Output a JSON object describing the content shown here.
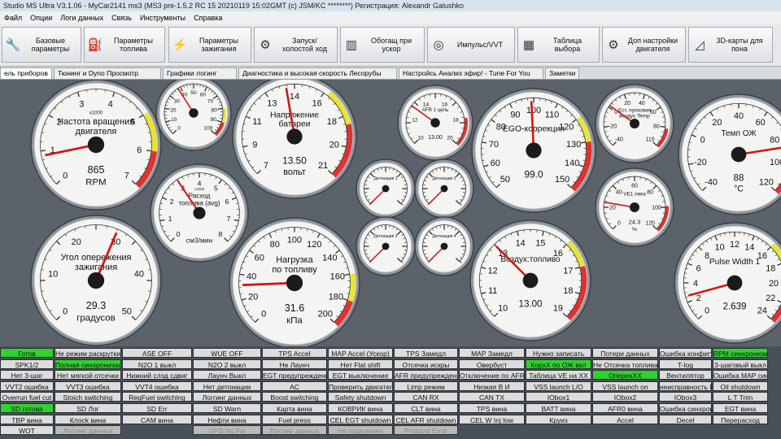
{
  "window": {
    "title": "Studio MS Ultra V3.1.06 - MyCar2141 ms3 (MS3 pre-1.5.2 RC 15  20210119 15:02GMT (c) JSM/KC ********) Регистрация: Alexandr Galushko"
  },
  "menu": [
    "Файл",
    "Опции",
    "Логи данных",
    "Связь",
    "Инструменты",
    "Справка"
  ],
  "toolbar": [
    {
      "label": "Базовые параметры",
      "icon": "wrench-icon",
      "glyph": "🔧"
    },
    {
      "label": "Параметры топлива",
      "icon": "injector-icon",
      "glyph": "⛽"
    },
    {
      "label": "Параметры зажигания",
      "icon": "spark-plug-icon",
      "glyph": "⚡"
    },
    {
      "label": "Запуск/ холостой ход",
      "icon": "idle-valve-icon",
      "glyph": "⚙"
    },
    {
      "label": "Обогащ при ускор",
      "icon": "accel-pedal-icon",
      "glyph": "▥"
    },
    {
      "label": "Импульс/VVT",
      "icon": "turbo-icon",
      "glyph": "◎"
    },
    {
      "label": "Таблица выбора",
      "icon": "table-icon",
      "glyph": "▦"
    },
    {
      "label": "Доп настройки двигателя",
      "icon": "engine-icon",
      "glyph": "⚙"
    },
    {
      "label": "3D-карты для пона",
      "icon": "3d-map-icon",
      "glyph": "◿"
    }
  ],
  "tabs": [
    "ель приборов",
    "Тюнинг и Dyno Просмотр",
    "Графики логинг",
    "Диагностика и высокая скорость Лесорубы",
    "Настройсь Анализ эфир! - Tune For You",
    "Заметки"
  ],
  "gauges": [
    {
      "id": "rpm",
      "title1": "Частота вращения",
      "title2": "двигателя",
      "mult": "x1000",
      "value": "865",
      "unit": "RPM",
      "min": 0,
      "max": 7,
      "val": 0.865,
      "ticks": [
        "0",
        "1",
        "2",
        "3",
        "4",
        "5",
        "6",
        "7"
      ],
      "redFrom": 6,
      "yellowFrom": 5
    },
    {
      "id": "mini-top",
      "title1": "",
      "title2": "",
      "mult": "",
      "value": "",
      "unit": "",
      "min": 0,
      "max": 100,
      "val": 38,
      "ticks": [
        "0",
        "10",
        "20",
        "30",
        "40",
        "50",
        "60",
        "70",
        "80",
        "90",
        "100"
      ],
      "redFrom": 90,
      "yellowFrom": 80
    },
    {
      "id": "battery",
      "title1": "Напряжение",
      "title2": "батареи",
      "mult": "",
      "value": "13.50",
      "unit": "вольт",
      "min": 7,
      "max": 21,
      "val": 13.5,
      "ticks": [
        "7",
        "9",
        "11",
        "13",
        "14",
        "16",
        "18",
        "20",
        "21"
      ],
      "redFrom": 18,
      "yellowFrom": 16
    },
    {
      "id": "fuel-flow",
      "title1": "Расход",
      "title2": "топлива (avg)",
      "mult": "x1000",
      "value": "",
      "unit": "см3/мин",
      "min": 0,
      "max": 8,
      "val": 3.0,
      "ticks": [
        "0",
        "1",
        "2",
        "3",
        "4",
        "5",
        "6",
        "7",
        "8"
      ],
      "redFrom": 99,
      "yellowFrom": 99
    },
    {
      "id": "ign",
      "title1": "Угол опережения",
      "title2": "зажигания",
      "mult": "",
      "value": "29.3",
      "unit": "градусов",
      "min": 0,
      "max": 50,
      "val": 29.3,
      "ticks": [
        "0",
        "10",
        "20",
        "30",
        "40",
        "50"
      ],
      "redFrom": 99,
      "yellowFrom": 99
    },
    {
      "id": "map",
      "title1": "Нагрузка",
      "title2": "по топливу",
      "mult": "",
      "value": "31.6",
      "unit": "кПа",
      "min": 0,
      "max": 200,
      "val": 31.6,
      "ticks": [
        "0",
        "20",
        "40",
        "60",
        "80",
        "100",
        "120",
        "140",
        "160",
        "180",
        "200"
      ],
      "redFrom": 180,
      "yellowFrom": 160
    },
    {
      "id": "afr",
      "title1": "AFR 1 цель",
      "title2": "",
      "mult": "",
      "value": "13.00",
      "unit": "",
      "min": 10,
      "max": 20,
      "val": 13.0,
      "ticks": [
        "10",
        "12",
        "14",
        "16",
        "18",
        "20"
      ],
      "redFrom": 18,
      "yellowFrom": 99
    },
    {
      "id": "knock1",
      "title1": "Детонация 1",
      "title2": "",
      "mult": "",
      "value": "",
      "unit": "",
      "min": 0,
      "max": 100,
      "val": 0,
      "ticks": [],
      "redFrom": 99,
      "yellowFrom": 99
    },
    {
      "id": "knock2",
      "title1": "Детонация 2",
      "title2": "",
      "mult": "",
      "value": "",
      "unit": "",
      "min": 0,
      "max": 100,
      "val": 0,
      "ticks": [],
      "redFrom": 99,
      "yellowFrom": 99
    },
    {
      "id": "knock3",
      "title1": "Детонация 3",
      "title2": "",
      "mult": "",
      "value": "",
      "unit": "",
      "min": 0,
      "max": 100,
      "val": 0,
      "ticks": [],
      "redFrom": 99,
      "yellowFrom": 99
    },
    {
      "id": "knock4",
      "title1": "Детонация 4",
      "title2": "",
      "mult": "",
      "value": "",
      "unit": "",
      "min": 0,
      "max": 100,
      "val": 0,
      "ticks": [],
      "redFrom": 99,
      "yellowFrom": 99
    },
    {
      "id": "ego",
      "title1": "EGO-коррекция",
      "title2": "",
      "mult": "",
      "value": "99.0",
      "unit": "",
      "min": 50,
      "max": 150,
      "val": 99.0,
      "ticks": [
        "50",
        "60",
        "70",
        "80",
        "90",
        "100",
        "110",
        "120",
        "130",
        "140",
        "150"
      ],
      "redFrom": 130,
      "yellowFrom": 120
    },
    {
      "id": "afr-main",
      "title1": "Воздух:топливо",
      "title2": "",
      "mult": "",
      "value": "13.00",
      "unit": "",
      "min": 10,
      "max": 19,
      "val": 13.0,
      "ticks": [
        "10",
        "11",
        "12",
        "13",
        "14",
        "15",
        "16",
        "17",
        "18",
        "19"
      ],
      "redFrom": 17,
      "yellowFrom": 16
    },
    {
      "id": "est",
      "title1": "Ест. пусковая",
      "title2": "воздух Temp",
      "mult": "",
      "value": "",
      "unit": "",
      "min": -40,
      "max": 110,
      "val": 5,
      "ticks": [
        "-40",
        "-20",
        "0",
        "20",
        "40",
        "60",
        "80",
        "110"
      ],
      "redFrom": 90,
      "yellowFrom": 99
    },
    {
      "id": "ve",
      "title1": "VE1 пика",
      "title2": "",
      "mult": "",
      "value": "24.3",
      "unit": "%",
      "min": 0,
      "max": 120,
      "val": 24.3,
      "ticks": [
        "0",
        "20",
        "40",
        "60",
        "80",
        "100",
        "120"
      ],
      "redFrom": 99,
      "yellowFrom": 99
    },
    {
      "id": "clt",
      "title1": "Темп ОЖ",
      "title2": "",
      "mult": "",
      "value": "88",
      "unit": "°C",
      "min": -40,
      "max": 120,
      "val": 88,
      "ticks": [
        "-40",
        "-20",
        "0",
        "20",
        "40",
        "60",
        "80",
        "100",
        "120"
      ],
      "redFrom": 100,
      "yellowFrom": 90
    },
    {
      "id": "pw",
      "title1": "Pulse Width 1",
      "title2": "",
      "mult": "",
      "value": "2.639",
      "unit": "",
      "min": 0,
      "max": 24,
      "val": 2.639,
      "ticks": [
        "0",
        "2",
        "4",
        "6",
        "8",
        "10",
        "12",
        "14",
        "16",
        "18",
        "20",
        "22",
        "24"
      ],
      "redFrom": 18,
      "yellowFrom": 16
    }
  ],
  "indicators": [
    [
      "Готов",
      "SPK1/2",
      "Нет 3-шаг",
      "VVT2 ошибка",
      "Overrun fuel cut",
      "SD готова",
      "TBP вина",
      "WOT"
    ],
    [
      "Не режим раскрутки",
      "Полная синхронизация RPM",
      "Нет мягкой отсечки",
      "VVT3 ошибка",
      "Stoich switching",
      "SD Лог",
      "Клосk вина",
      "Логгинг данных"
    ],
    [
      "ASE OFF",
      "N2O 1 выкл",
      "Нижний слэд сдвиг",
      "VVT4 ошибка",
      "ReqFuel switching",
      "SD Err",
      "CAM вина",
      ""
    ],
    [
      "WUE OFF",
      "N2O 2 выкл",
      "Лаунч Выкл",
      "Нет детонации",
      "Логгинг данных",
      "SD Warn",
      "Нефти вина",
      "GPS No Fix"
    ],
    [
      "TPS Accel",
      "Не Лаунч",
      "EGT предупреждение",
      "AC",
      "Boost switching",
      "Карта вина",
      "Fuel press",
      "Логгинг данных"
    ],
    [
      "MAP Accel (Ускор)",
      "Нет Flat shift",
      "EGT выключение",
      "Проверить двигатель",
      "Safety shutdown",
      "КОВРИК вина",
      "CEL EGT shutdown",
      "Не подключен"
    ],
    [
      "TPS Замедл",
      "Отсечка искры",
      "AFR предупреждение",
      "Limp режим",
      "CAN RX",
      "CLT вина",
      "CEL AFR shutdown",
      "Protocol Error"
    ],
    [
      "MAP Замедл",
      "Овербуст",
      "Отключение по AFR",
      "Низкая В И",
      "CAN TX",
      "TPS вина",
      "CEL W Inj low",
      ""
    ],
    [
      "Нужно записать",
      "КорхХ по ОЖ вкл",
      "Таблица VE на ХХ",
      "VSS launch L/O",
      "IObox1",
      "BATT вина",
      "Круиз",
      ""
    ],
    [
      "Потери данных",
      "Не Отсечка топлива",
      "ОперехХХ",
      "VSS launch on",
      "IObox2",
      "AFR0 вина",
      "Accel",
      ""
    ],
    [
      "Ошибка конфигурации",
      "T-log",
      "Вентилятор",
      "неисправность DBW",
      "IObox3",
      "Ошибка синхронизации",
      "Decel",
      ""
    ],
    [
      "RPM синхронизирован",
      "3-шаговый выкл",
      "Ошибка MAP синхронизац",
      "Oil shutdown",
      "L T Trim",
      "EGT вина",
      "Перерасход",
      ""
    ]
  ],
  "indicator_colors": {
    "green": "#2fd22f",
    "red": "#e02020",
    "grey": "#dcdcdc",
    "dim": "#b9b9b9"
  }
}
